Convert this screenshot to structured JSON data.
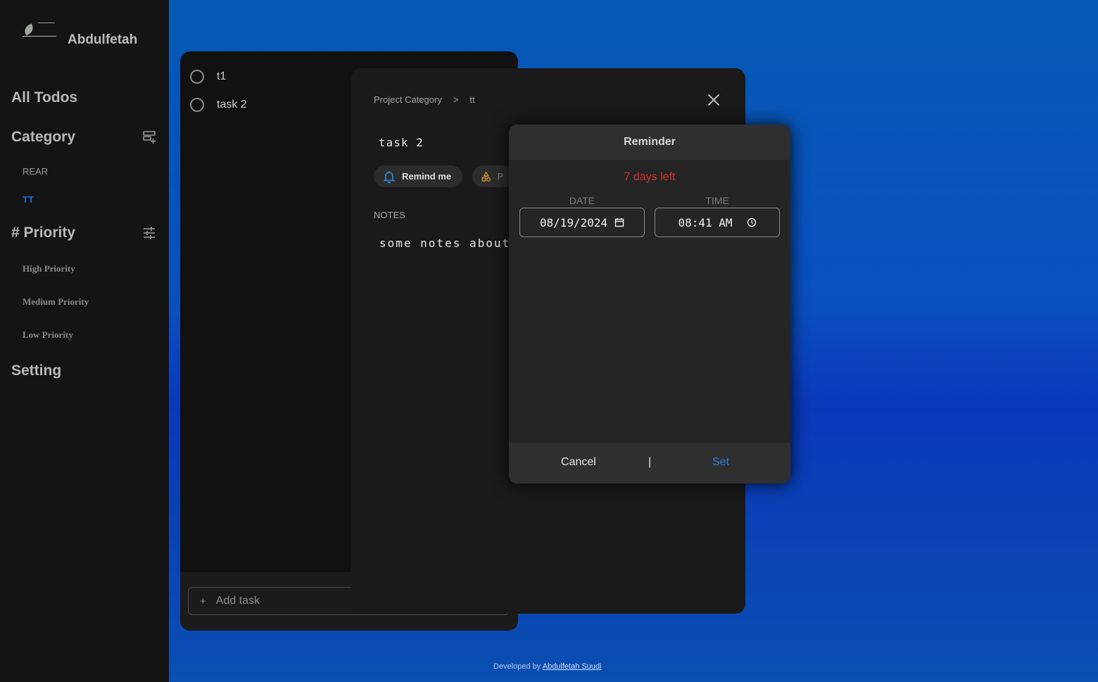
{
  "sidebar": {
    "profile_name": "Abdulfetah",
    "all_todos": "All Todos",
    "category_heading": "Category",
    "categories": [
      "REAR",
      "TT"
    ],
    "priority_heading": "# Priority",
    "priorities": [
      "High Priority",
      "Medium Priority",
      "Low Priority"
    ],
    "setting": "Setting"
  },
  "list": {
    "todos": [
      "t1",
      "task 2"
    ],
    "add_task_placeholder": "Add task",
    "add_task_plus": "+"
  },
  "detail": {
    "breadcrumb": [
      "Project Category",
      ">",
      "tt"
    ],
    "task_title": "task 2",
    "remind_label": "Remind me",
    "priority_label": "P",
    "notes_label": "NOTES",
    "notes_text": "some notes about"
  },
  "reminder": {
    "title": "Reminder",
    "days_left": "7 days left",
    "date_label": "DATE",
    "date_value": "08/19/2024",
    "time_label": "TIME",
    "time_value": "08:41 AM",
    "cancel_label": "Cancel",
    "separator": "|",
    "set_label": "Set"
  },
  "footer": {
    "prefix": "Developed by",
    "author": "Abdulfetah Suudi"
  },
  "colors": {
    "accent": "#2a7de1",
    "warning": "#d3302f",
    "sidebar_bg": "#141414",
    "panel_bg": "#1a1a1a"
  }
}
